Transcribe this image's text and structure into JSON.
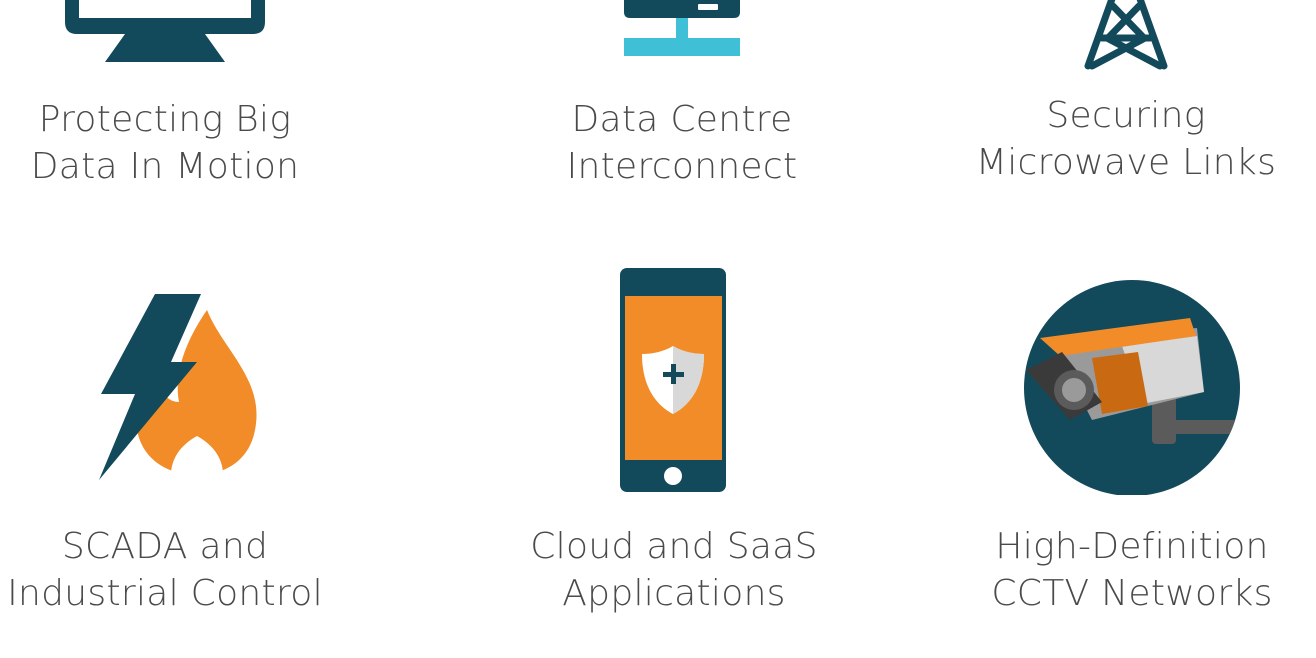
{
  "colors": {
    "navy": "#124a5c",
    "orange": "#f28c28",
    "cyan": "#3fc0d6",
    "text": "#4a4a4a",
    "light_grey": "#d8d8d8",
    "grey": "#9a9a9a",
    "dark_grey": "#5b5b5b"
  },
  "tiles": [
    {
      "icon": "monitor-icon",
      "line1": "Protecting Big",
      "line2": "Data In Motion"
    },
    {
      "icon": "server-network-icon",
      "line1": "Data Centre",
      "line2": "Interconnect"
    },
    {
      "icon": "transmission-tower-icon",
      "line1": "Securing",
      "line2": "Microwave Links"
    },
    {
      "icon": "lightning-fire-icon",
      "line1": "SCADA and",
      "line2": "Industrial Control"
    },
    {
      "icon": "smartphone-shield-icon",
      "line1": "Cloud and SaaS",
      "line2": "Applications"
    },
    {
      "icon": "cctv-camera-icon",
      "line1": "High-Definition",
      "line2": "CCTV Networks"
    }
  ]
}
